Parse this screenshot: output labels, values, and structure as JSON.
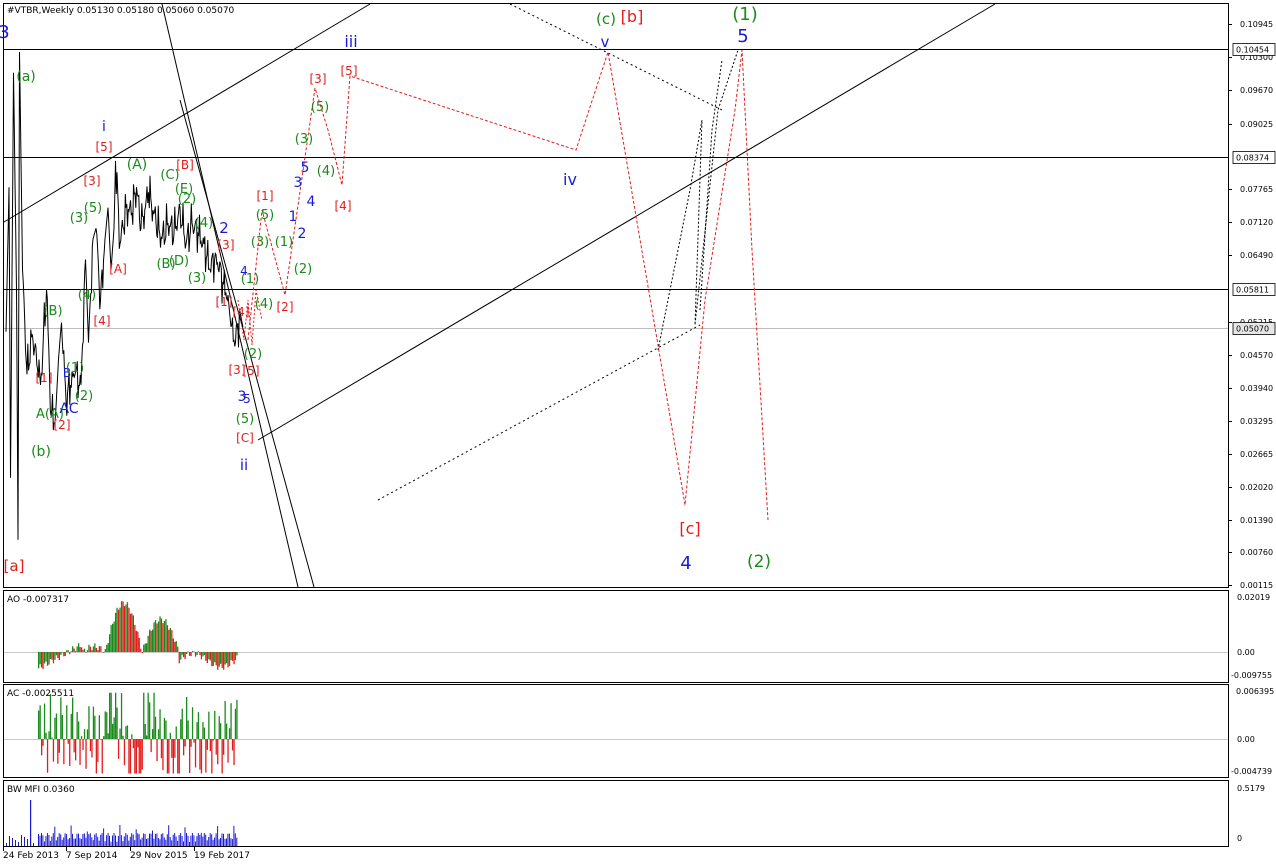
{
  "colors": {
    "red": "#e31c1c",
    "green": "#1a8a1a",
    "blue": "#1a1ad6",
    "black": "#000000",
    "ao_up": "#1a8a1a",
    "ao_down": "#e31c1c",
    "mfi": "#1a1ad6"
  },
  "chart_data": [
    {
      "type": "line",
      "panel": "main",
      "header": "#VTBR,Weekly  0.05130 0.05180 0.05060 0.05070",
      "y_ticks": [
        "0.10945",
        "0.10300",
        "0.09670",
        "0.09025",
        "0.08374",
        "0.07765",
        "0.07120",
        "0.06490",
        "0.05811",
        "0.05215",
        "0.05070",
        "0.04570",
        "0.03940",
        "0.03295",
        "0.02665",
        "0.02020",
        "0.01390",
        "0.00760",
        "0.00115"
      ],
      "highlighted_levels": [
        {
          "label": "0.10454",
          "value": 0.10454
        },
        {
          "label": "0.08374",
          "value": 0.08374
        },
        {
          "label": "0.05811",
          "value": 0.05811
        },
        {
          "label": "0.05070",
          "value": 0.0507
        }
      ],
      "x_ticks": [
        "24 Feb 2013",
        "7 Sep 2014",
        "29 Nov 2015",
        "19 Feb 2017"
      ],
      "ylim": [
        0.00115,
        0.11
      ],
      "projections": {
        "red": [
          {
            "week": 225,
            "value": 0.0595
          },
          {
            "week": 250,
            "value": 0.0765
          },
          {
            "week": 268,
            "value": 0.058
          },
          {
            "week": 295,
            "value": 0.0835
          },
          {
            "week": 318,
            "value": 0.0905
          },
          {
            "week": 330,
            "value": 0.0785
          },
          {
            "week": 348,
            "value": 0.1
          }
        ]
      },
      "labels": [
        {
          "text": "3",
          "color": "blue"
        },
        {
          "text": "(a)",
          "color": "green"
        },
        {
          "text": "[a]",
          "color": "red"
        },
        {
          "text": "(b)",
          "color": "green"
        },
        {
          "text": "i",
          "color": "blue"
        },
        {
          "text": "[5]",
          "color": "red"
        },
        {
          "text": "[3]",
          "color": "red"
        },
        {
          "text": "(3)",
          "color": "green"
        },
        {
          "text": "(5)",
          "color": "green"
        },
        {
          "text": "(4)",
          "color": "green"
        },
        {
          "text": "[4]",
          "color": "red"
        },
        {
          "text": "(B)",
          "color": "green"
        },
        {
          "text": "[1]",
          "color": "red"
        },
        {
          "text": "B",
          "color": "blue"
        },
        {
          "text": "(1)",
          "color": "green"
        },
        {
          "text": "(2)",
          "color": "green"
        },
        {
          "text": "A(A)",
          "color": "green"
        },
        {
          "text": "AC",
          "color": "blue"
        },
        {
          "text": "[2]",
          "color": "red"
        },
        {
          "text": "(A)",
          "color": "green"
        },
        {
          "text": "[A]",
          "color": "red"
        },
        {
          "text": "(C)",
          "color": "green"
        },
        {
          "text": "[B]",
          "color": "red"
        },
        {
          "text": "(E)",
          "color": "green"
        },
        {
          "text": "(2)",
          "color": "green"
        },
        {
          "text": "(B)",
          "color": "green"
        },
        {
          "text": "(D)",
          "color": "green"
        },
        {
          "text": "(3)",
          "color": "green"
        },
        {
          "text": "(4)",
          "color": "green"
        },
        {
          "text": "2",
          "color": "blue"
        },
        {
          "text": "[3]",
          "color": "red"
        },
        {
          "text": "[1]",
          "color": "red"
        },
        {
          "text": "4",
          "color": "blue"
        },
        {
          "text": "(1)",
          "color": "green"
        },
        {
          "text": "(4)",
          "color": "green"
        },
        {
          "text": "[4]",
          "color": "red"
        },
        {
          "text": "(2)",
          "color": "green"
        },
        {
          "text": "[3]",
          "color": "red"
        },
        {
          "text": "[5]",
          "color": "red"
        },
        {
          "text": "3",
          "color": "blue"
        },
        {
          "text": "5",
          "color": "blue"
        },
        {
          "text": "(5)",
          "color": "green"
        },
        {
          "text": "[C]",
          "color": "red"
        },
        {
          "text": "ii",
          "color": "blue"
        },
        {
          "text": "[1]",
          "color": "red"
        },
        {
          "text": "(5)",
          "color": "green"
        },
        {
          "text": "(3)",
          "color": "green"
        },
        {
          "text": "(1)",
          "color": "green"
        },
        {
          "text": "(2)",
          "color": "green"
        },
        {
          "text": "[2]",
          "color": "red"
        },
        {
          "text": "1",
          "color": "blue"
        },
        {
          "text": "2",
          "color": "blue"
        },
        {
          "text": "3",
          "color": "blue"
        },
        {
          "text": "4",
          "color": "blue"
        },
        {
          "text": "5",
          "color": "blue"
        },
        {
          "text": "(3)",
          "color": "green"
        },
        {
          "text": "(4)",
          "color": "green"
        },
        {
          "text": "(5)",
          "color": "green"
        },
        {
          "text": "[3]",
          "color": "red"
        },
        {
          "text": "[5]",
          "color": "red"
        },
        {
          "text": "[4]",
          "color": "red"
        },
        {
          "text": "iii",
          "color": "blue"
        },
        {
          "text": "iv",
          "color": "blue"
        },
        {
          "text": "(c)",
          "color": "green"
        },
        {
          "text": "[b]",
          "color": "red"
        },
        {
          "text": "v",
          "color": "blue"
        },
        {
          "text": "(1)",
          "color": "green"
        },
        {
          "text": "5",
          "color": "blue"
        },
        {
          "text": "[c]",
          "color": "red"
        },
        {
          "text": "4",
          "color": "blue"
        },
        {
          "text": "(2)",
          "color": "green"
        }
      ]
    },
    {
      "type": "bar",
      "panel": "AO",
      "header": "AO -0.007317",
      "y_ticks": [
        "0.02019",
        "0.00",
        "-0.009755"
      ],
      "ylim": [
        -0.009755,
        0.02019
      ]
    },
    {
      "type": "bar",
      "panel": "AC",
      "header": "AC -0.0025511",
      "y_ticks": [
        "0.006395",
        "0.00",
        "-0.004739"
      ],
      "ylim": [
        -0.004739,
        0.006395
      ]
    },
    {
      "type": "bar",
      "panel": "BW MFI",
      "header": "BW MFI 0.0360",
      "y_ticks": [
        "0.5179",
        "0"
      ],
      "ylim": [
        0,
        0.5179
      ]
    }
  ]
}
